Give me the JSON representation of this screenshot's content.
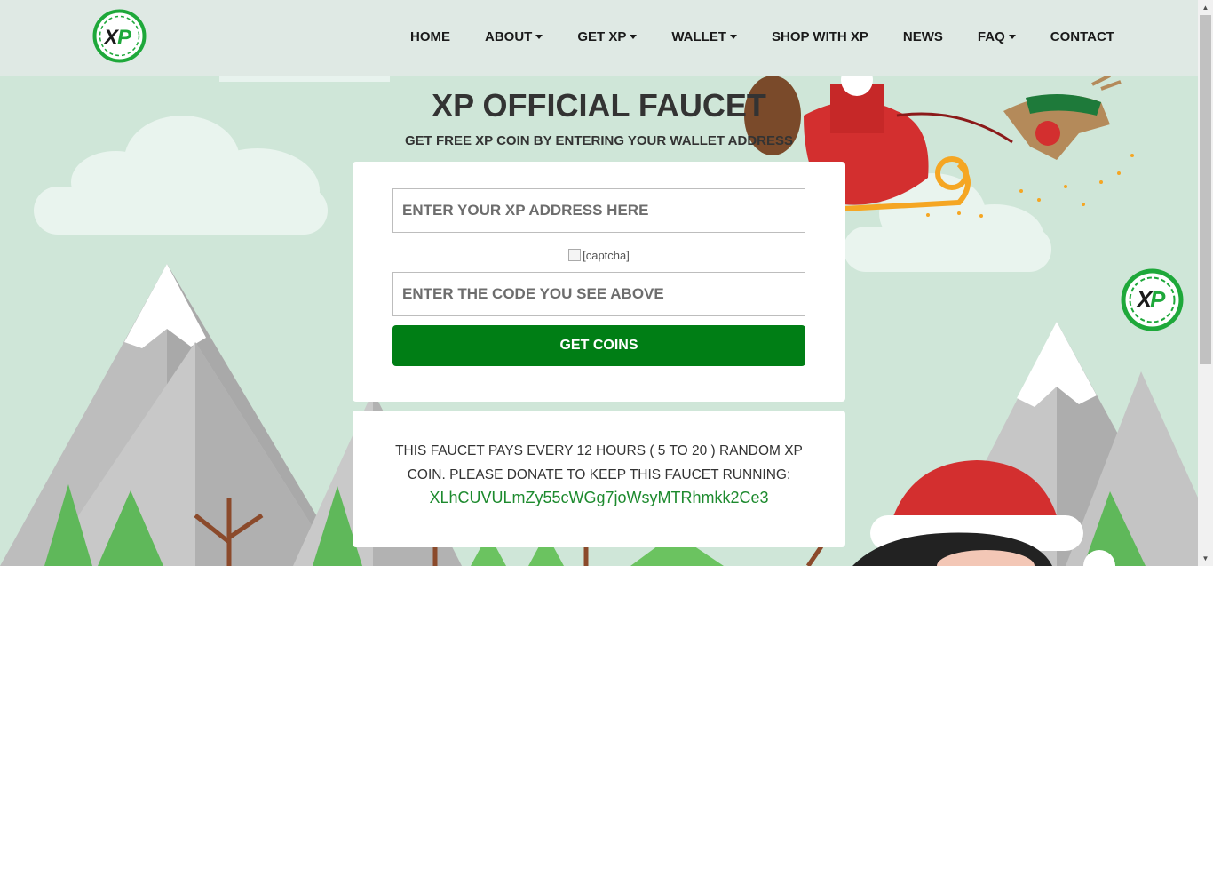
{
  "nav": {
    "items": [
      {
        "label": "HOME",
        "dropdown": false
      },
      {
        "label": "ABOUT",
        "dropdown": true
      },
      {
        "label": "GET XP",
        "dropdown": true
      },
      {
        "label": "WALLET",
        "dropdown": true
      },
      {
        "label": "SHOP WITH XP",
        "dropdown": false
      },
      {
        "label": "NEWS",
        "dropdown": false
      },
      {
        "label": "FAQ",
        "dropdown": true
      },
      {
        "label": "CONTACT",
        "dropdown": false
      }
    ]
  },
  "hero": {
    "title": "XP OFFICIAL FAUCET",
    "subtitle": "GET FREE XP COIN BY ENTERING YOUR WALLET ADDRESS"
  },
  "form": {
    "address_placeholder": "ENTER YOUR XP ADDRESS HERE",
    "captcha_alt": "[captcha]",
    "code_placeholder": "ENTER THE CODE YOU SEE ABOVE",
    "submit_label": "GET COINS"
  },
  "info": {
    "text": "THIS FAUCET PAYS EVERY 12 HOURS ( 5 TO 20 ) RANDOM XP COIN. PLEASE DONATE TO KEEP THIS FAUCET RUNNING:",
    "donation_address": "XLhCUVULmZy55cWGg7joWsyMTRhmkk2Ce3"
  },
  "colors": {
    "header_bg": "#dfe9e4",
    "scene_bg": "#cfe7da",
    "button": "#007e15",
    "address_text": "#1d8a2e"
  },
  "icons": {
    "logo": "xp-logo-icon",
    "badge": "xp-badge-icon",
    "caret": "caret-down-icon"
  }
}
